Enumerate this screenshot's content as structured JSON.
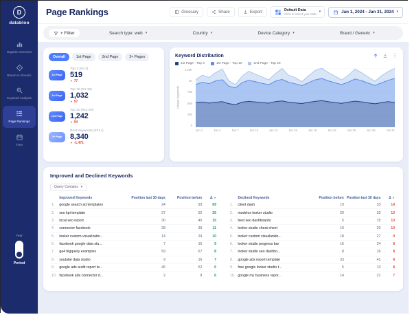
{
  "colors": {
    "accent": "#4d7cfe",
    "negative": "#e8483f",
    "positive": "#17a05d",
    "sidebar": "#1c2b6b",
    "canvas": "#e9edf8"
  },
  "sidebar": {
    "logo_letter": "D",
    "logo_text": "databloo",
    "items": [
      {
        "label": "Organic Overview"
      },
      {
        "label": "Brand vs Generic"
      },
      {
        "label": "Keyword Analysis"
      },
      {
        "label": "Page Rankings"
      },
      {
        "label": "Time"
      }
    ],
    "year_label": "Year",
    "period_label": "Period"
  },
  "header": {
    "title": "Page Rankings",
    "glossary": "Glossary",
    "share": "Share",
    "export": "Export",
    "data_selector_title": "Default Data",
    "data_selector_subtitle": "Click to select your data",
    "date_range": "Jan 1, 2024 - Jan 31, 2024"
  },
  "filters": {
    "add_filter": "+ Filter",
    "dropdowns": [
      {
        "label": "Search type: web"
      },
      {
        "label": "Country"
      },
      {
        "label": "Device Category"
      },
      {
        "label": "Brand / Generic"
      }
    ]
  },
  "rank_panel": {
    "tabs": [
      {
        "label": "Overall"
      },
      {
        "label": "1st Page"
      },
      {
        "label": "2nd Page"
      },
      {
        "label": "3+ Pages"
      }
    ],
    "stats": [
      {
        "badge": "1st Page",
        "label": "Top 3 (#1-3)",
        "value": "519",
        "delta": "77"
      },
      {
        "badge": "1st Page",
        "label": "Top 10 (#4-10)",
        "value": "1,032",
        "delta": "97"
      },
      {
        "badge": "2nd Page",
        "label": "Top 20 (#11-20)",
        "value": "1,242",
        "delta": "94"
      },
      {
        "badge": "3+ Page",
        "label": "Rest Keywords (#21+)",
        "value": "8,340",
        "delta": "-1,471"
      }
    ]
  },
  "chart_data": {
    "type": "area",
    "title": "Keyword Distribution",
    "ylabel": "Unique Keywords",
    "ylim": [
      0,
      1250
    ],
    "yticks": [
      "0",
      "250",
      "500",
      "750",
      "1K",
      "1.25K"
    ],
    "xticks": [
      "Jan 1",
      "Jan 4",
      "Jan 7",
      "Jan 10",
      "Jan 13",
      "Jan 16",
      "Jan 19",
      "Jan 22",
      "Jan 25",
      "Jan 28",
      "Jan 31"
    ],
    "legend_position": "top",
    "grid": true,
    "series": [
      {
        "name": "1st Page - Top 3",
        "color": "#23407f",
        "fill": "rgba(35,64,127,0.30)",
        "values": [
          520,
          532,
          510,
          526,
          541,
          498,
          478,
          530,
          546,
          534,
          519,
          508,
          542,
          556,
          529,
          514,
          501,
          526,
          547,
          561,
          539,
          521,
          504,
          531,
          551,
          536,
          514,
          496,
          521,
          541,
          519
        ]
      },
      {
        "name": "1st Page - Top 10",
        "color": "#5b8bea",
        "fill": "rgba(91,139,234,0.35)",
        "values": [
          903,
          952,
          921,
          978,
          1004,
          868,
          831,
          942,
          991,
          962,
          929,
          899,
          972,
          1012,
          951,
          918,
          879,
          941,
          1002,
          1031,
          979,
          938,
          902,
          953,
          1021,
          982,
          931,
          884,
          939,
          991,
          1032
        ]
      },
      {
        "name": "2nd Page - Top 20",
        "color": "#a9c6ee",
        "fill": "rgba(169,198,238,0.45)",
        "values": [
          1003,
          1102,
          1051,
          1152,
          1231,
          978,
          902,
          1082,
          1183,
          1121,
          1062,
          1001,
          1132,
          1241,
          1101,
          1049,
          961,
          1089,
          1201,
          1248,
          1152,
          1079,
          1002,
          1099,
          1229,
          1151,
          1061,
          969,
          1088,
          1179,
          1242
        ]
      }
    ]
  },
  "keywords_section": {
    "title": "Improved and Declined Keywords",
    "query_filter": "Query Contains",
    "improved": {
      "headers": [
        "Improved Keywords",
        "Position last 30 days",
        "Position before",
        "Δ"
      ],
      "rows": [
        [
          "google search ad templates",
          "24",
          "93",
          "69"
        ],
        [
          "seo kpi template",
          "27",
          "52",
          "25"
        ],
        [
          "local seo report",
          "30",
          "45",
          "15"
        ],
        [
          "connector facebook",
          "28",
          "39",
          "11"
        ],
        [
          "looker custom visualizatio...",
          "14",
          "24",
          "10"
        ],
        [
          "facebook google data stu...",
          "7",
          "16",
          "9"
        ],
        [
          "ga4 bigquery examples",
          "59",
          "67",
          "8"
        ],
        [
          "youtube data studio",
          "9",
          "16",
          "7"
        ],
        [
          "google ads audit report te...",
          "46",
          "52",
          "6"
        ],
        [
          "facebook ads connector d...",
          "2",
          "8",
          "6"
        ]
      ]
    },
    "declined": {
      "headers": [
        "Declined Keywords",
        "Position before",
        "Position last 30 days",
        "Δ"
      ],
      "rows": [
        [
          "client dash",
          "19",
          "33",
          "14"
        ],
        [
          "modelos looker studio",
          "20",
          "33",
          "13"
        ],
        [
          "best seo dashboards",
          "5",
          "15",
          "10"
        ],
        [
          "looker studio cheat sheet",
          "10",
          "20",
          "10"
        ],
        [
          "looker custom visualizatio...",
          "18",
          "27",
          "9"
        ],
        [
          "looker studio progress bar",
          "16",
          "24",
          "8"
        ],
        [
          "looker studio seo dashbo...",
          "8",
          "16",
          "8"
        ],
        [
          "google ads report template",
          "33",
          "41",
          "8"
        ],
        [
          "free google looker studio t...",
          "5",
          "13",
          "8"
        ],
        [
          "google my business repor...",
          "14",
          "21",
          "7"
        ]
      ]
    }
  }
}
